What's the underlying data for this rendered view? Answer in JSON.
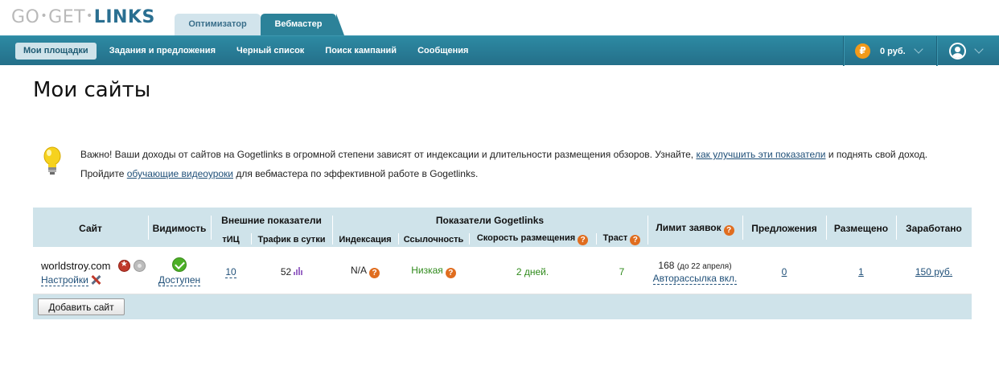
{
  "logo": {
    "part1": "GO",
    "part2": "GET",
    "part3": "LINKS",
    "dot": "•"
  },
  "top_tabs": [
    {
      "label": "Оптимизатор",
      "active": false
    },
    {
      "label": "Вебмастер",
      "active": true
    }
  ],
  "nav": {
    "items": [
      {
        "label": "Мои площадки",
        "current": true
      },
      {
        "label": "Задания и предложения",
        "current": false
      },
      {
        "label": "Черный список",
        "current": false
      },
      {
        "label": "Поиск кампаний",
        "current": false
      },
      {
        "label": "Сообщения",
        "current": false
      }
    ],
    "currency_symbol": "₽",
    "balance": "0 руб."
  },
  "page": {
    "title": "Мои сайты"
  },
  "notice": {
    "t1": "Важно! Ваши доходы от сайтов на Gogetlinks в огромной степени зависят от индексации и длительности размещения обзоров. Узнайте, ",
    "link1": "как улучшить эти показатели",
    "t2": " и поднять свой доход. Пройдите ",
    "link2": "обучающие видеоуроки",
    "t3": " для вебмастера по эффективной работе в Gogetlinks."
  },
  "table": {
    "headers": {
      "site": "Сайт",
      "visibility": "Видимость",
      "external": "Внешние показатели",
      "tic": "тИЦ",
      "traffic": "Трафик в сутки",
      "gogetlinks": "Показатели Gogetlinks",
      "indexing": "Индексация",
      "linkiness": "Ссылочность",
      "speed": "Скорость размещения",
      "trust": "Траст",
      "limit": "Лимит заявок",
      "offers": "Предложения",
      "placed": "Размещено",
      "earned": "Заработано"
    },
    "row": {
      "site": "worldstroy.com",
      "settings": "Настройки",
      "visibility": "Доступен",
      "tic": "10",
      "traffic": "52",
      "indexing": "N/A",
      "linkiness": "Низкая",
      "speed": "2 дней.",
      "trust": "7",
      "limit": "168",
      "limit_note": "(до 22 апреля)",
      "autosend": "Авторассылка вкл.",
      "offers": "0",
      "placed": "1",
      "earned": "150 руб."
    },
    "add_button": "Добавить сайт"
  }
}
